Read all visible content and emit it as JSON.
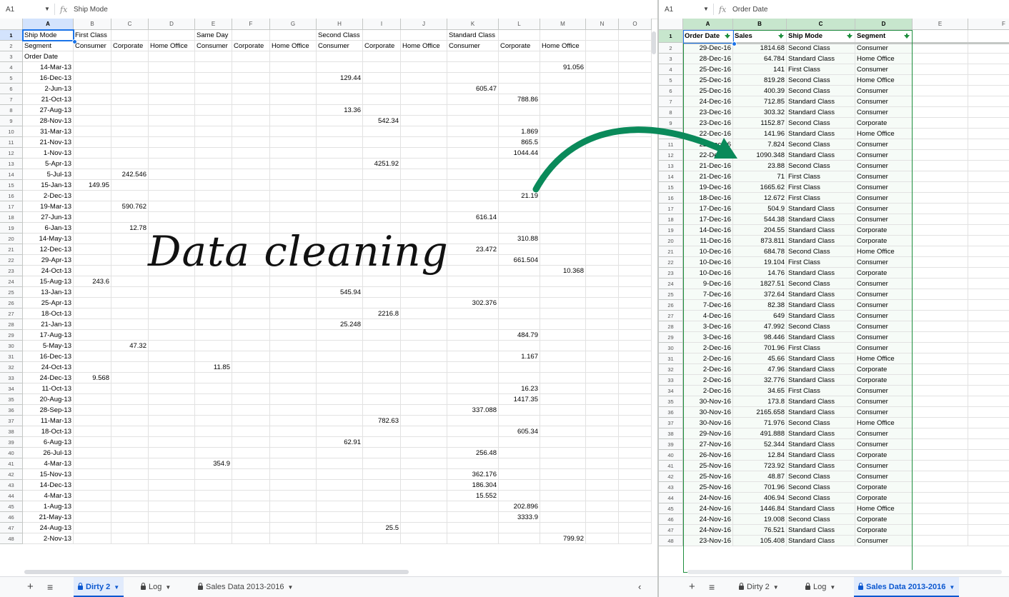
{
  "left": {
    "name_box": "A1",
    "formula": "Ship Mode",
    "columns": [
      "A",
      "B",
      "C",
      "D",
      "E",
      "F",
      "G",
      "H",
      "I",
      "J",
      "K",
      "L",
      "M",
      "N",
      "O"
    ],
    "rows": [
      [
        "Ship Mode",
        "First Class",
        "",
        "",
        "Same Day",
        "",
        "",
        "Second Class",
        "",
        "",
        "Standard Class",
        "",
        "",
        "",
        ""
      ],
      [
        "Segment",
        "Consumer",
        "Corporate",
        "Home Office",
        "Consumer",
        "Corporate",
        "Home Office",
        "Consumer",
        "Corporate",
        "Home Office",
        "Consumer",
        "Corporate",
        "Home Office",
        "",
        ""
      ],
      [
        "Order Date",
        "",
        "",
        "",
        "",
        "",
        "",
        "",
        "",
        "",
        "",
        "",
        "",
        "",
        ""
      ],
      [
        "14-Mar-13",
        "",
        "",
        "",
        "",
        "",
        "",
        "",
        "",
        "",
        "",
        "",
        "91.056",
        "",
        ""
      ],
      [
        "16-Dec-13",
        "",
        "",
        "",
        "",
        "",
        "",
        "129.44",
        "",
        "",
        "",
        "",
        "",
        "",
        ""
      ],
      [
        "2-Jun-13",
        "",
        "",
        "",
        "",
        "",
        "",
        "",
        "",
        "",
        "605.47",
        "",
        "",
        "",
        ""
      ],
      [
        "21-Oct-13",
        "",
        "",
        "",
        "",
        "",
        "",
        "",
        "",
        "",
        "",
        "788.86",
        "",
        "",
        ""
      ],
      [
        "27-Aug-13",
        "",
        "",
        "",
        "",
        "",
        "",
        "13.36",
        "",
        "",
        "",
        "",
        "",
        "",
        ""
      ],
      [
        "28-Nov-13",
        "",
        "",
        "",
        "",
        "",
        "",
        "",
        "542.34",
        "",
        "",
        "",
        "",
        "",
        ""
      ],
      [
        "31-Mar-13",
        "",
        "",
        "",
        "",
        "",
        "",
        "",
        "",
        "",
        "",
        "1.869",
        "",
        "",
        ""
      ],
      [
        "21-Nov-13",
        "",
        "",
        "",
        "",
        "",
        "",
        "",
        "",
        "",
        "",
        "865.5",
        "",
        "",
        ""
      ],
      [
        "1-Nov-13",
        "",
        "",
        "",
        "",
        "",
        "",
        "",
        "",
        "",
        "",
        "1044.44",
        "",
        "",
        ""
      ],
      [
        "5-Apr-13",
        "",
        "",
        "",
        "",
        "",
        "",
        "",
        "4251.92",
        "",
        "",
        "",
        "",
        "",
        ""
      ],
      [
        "5-Jul-13",
        "",
        "242.546",
        "",
        "",
        "",
        "",
        "",
        "",
        "",
        "",
        "",
        "",
        "",
        ""
      ],
      [
        "15-Jan-13",
        "149.95",
        "",
        "",
        "",
        "",
        "",
        "",
        "",
        "",
        "",
        "",
        "",
        "",
        ""
      ],
      [
        "2-Dec-13",
        "",
        "",
        "",
        "",
        "",
        "",
        "",
        "",
        "",
        "",
        "21.19",
        "",
        "",
        ""
      ],
      [
        "19-Mar-13",
        "",
        "590.762",
        "",
        "",
        "",
        "",
        "",
        "",
        "",
        "",
        "",
        "",
        "",
        ""
      ],
      [
        "27-Jun-13",
        "",
        "",
        "",
        "",
        "",
        "",
        "",
        "",
        "",
        "616.14",
        "",
        "",
        "",
        ""
      ],
      [
        "6-Jan-13",
        "",
        "12.78",
        "",
        "",
        "",
        "",
        "",
        "",
        "",
        "",
        "",
        "",
        "",
        ""
      ],
      [
        "14-May-13",
        "",
        "",
        "",
        "",
        "",
        "",
        "",
        "",
        "",
        "",
        "310.88",
        "",
        "",
        ""
      ],
      [
        "12-Dec-13",
        "",
        "",
        "",
        "",
        "",
        "",
        "",
        "",
        "",
        "23.472",
        "",
        "",
        "",
        ""
      ],
      [
        "29-Apr-13",
        "",
        "",
        "",
        "",
        "",
        "",
        "",
        "",
        "",
        "",
        "661.504",
        "",
        "",
        ""
      ],
      [
        "24-Oct-13",
        "",
        "",
        "",
        "",
        "",
        "",
        "",
        "",
        "",
        "",
        "",
        "10.368",
        "",
        ""
      ],
      [
        "15-Aug-13",
        "243.6",
        "",
        "",
        "",
        "",
        "",
        "",
        "",
        "",
        "",
        "",
        "",
        "",
        ""
      ],
      [
        "13-Jan-13",
        "",
        "",
        "",
        "",
        "",
        "",
        "545.94",
        "",
        "",
        "",
        "",
        "",
        "",
        ""
      ],
      [
        "25-Apr-13",
        "",
        "",
        "",
        "",
        "",
        "",
        "",
        "",
        "",
        "302.376",
        "",
        "",
        "",
        ""
      ],
      [
        "18-Oct-13",
        "",
        "",
        "",
        "",
        "",
        "",
        "",
        "2216.8",
        "",
        "",
        "",
        "",
        "",
        ""
      ],
      [
        "21-Jan-13",
        "",
        "",
        "",
        "",
        "",
        "",
        "25.248",
        "",
        "",
        "",
        "",
        "",
        "",
        ""
      ],
      [
        "17-Aug-13",
        "",
        "",
        "",
        "",
        "",
        "",
        "",
        "",
        "",
        "",
        "484.79",
        "",
        "",
        ""
      ],
      [
        "5-May-13",
        "",
        "47.32",
        "",
        "",
        "",
        "",
        "",
        "",
        "",
        "",
        "",
        "",
        "",
        ""
      ],
      [
        "16-Dec-13",
        "",
        "",
        "",
        "",
        "",
        "",
        "",
        "",
        "",
        "",
        "1.167",
        "",
        "",
        ""
      ],
      [
        "24-Oct-13",
        "",
        "",
        "",
        "11.85",
        "",
        "",
        "",
        "",
        "",
        "",
        "",
        "",
        "",
        ""
      ],
      [
        "24-Dec-13",
        "9.568",
        "",
        "",
        "",
        "",
        "",
        "",
        "",
        "",
        "",
        "",
        "",
        "",
        ""
      ],
      [
        "11-Oct-13",
        "",
        "",
        "",
        "",
        "",
        "",
        "",
        "",
        "",
        "",
        "16.23",
        "",
        "",
        ""
      ],
      [
        "20-Aug-13",
        "",
        "",
        "",
        "",
        "",
        "",
        "",
        "",
        "",
        "",
        "1417.35",
        "",
        "",
        ""
      ],
      [
        "28-Sep-13",
        "",
        "",
        "",
        "",
        "",
        "",
        "",
        "",
        "",
        "337.088",
        "",
        "",
        "",
        ""
      ],
      [
        "11-Mar-13",
        "",
        "",
        "",
        "",
        "",
        "",
        "",
        "782.63",
        "",
        "",
        "",
        "",
        "",
        ""
      ],
      [
        "18-Oct-13",
        "",
        "",
        "",
        "",
        "",
        "",
        "",
        "",
        "",
        "",
        "605.34",
        "",
        "",
        ""
      ],
      [
        "6-Aug-13",
        "",
        "",
        "",
        "",
        "",
        "",
        "62.91",
        "",
        "",
        "",
        "",
        "",
        "",
        ""
      ],
      [
        "26-Jul-13",
        "",
        "",
        "",
        "",
        "",
        "",
        "",
        "",
        "",
        "256.48",
        "",
        "",
        "",
        ""
      ],
      [
        "4-Mar-13",
        "",
        "",
        "",
        "354.9",
        "",
        "",
        "",
        "",
        "",
        "",
        "",
        "",
        "",
        ""
      ],
      [
        "15-Nov-13",
        "",
        "",
        "",
        "",
        "",
        "",
        "",
        "",
        "",
        "362.176",
        "",
        "",
        "",
        ""
      ],
      [
        "14-Dec-13",
        "",
        "",
        "",
        "",
        "",
        "",
        "",
        "",
        "",
        "186.304",
        "",
        "",
        "",
        ""
      ],
      [
        "4-Mar-13",
        "",
        "",
        "",
        "",
        "",
        "",
        "",
        "",
        "",
        "15.552",
        "",
        "",
        "",
        ""
      ],
      [
        "1-Aug-13",
        "",
        "",
        "",
        "",
        "",
        "",
        "",
        "",
        "",
        "",
        "202.896",
        "",
        "",
        ""
      ],
      [
        "21-May-13",
        "",
        "",
        "",
        "",
        "",
        "",
        "",
        "",
        "",
        "",
        "3333.9",
        "",
        "",
        ""
      ],
      [
        "24-Aug-13",
        "",
        "",
        "",
        "",
        "",
        "",
        "",
        "25.5",
        "",
        "",
        "",
        "",
        "",
        ""
      ],
      [
        "2-Nov-13",
        "",
        "",
        "",
        "",
        "",
        "",
        "",
        "",
        "",
        "",
        "",
        "799.92",
        "",
        ""
      ]
    ],
    "tabs": [
      {
        "label": "Dirty 2",
        "locked": true,
        "active": true
      },
      {
        "label": "Log",
        "locked": true,
        "active": false
      },
      {
        "label": "Sales Data 2013-2016",
        "locked": true,
        "active": false
      }
    ]
  },
  "right": {
    "name_box": "A1",
    "formula": "Order Date",
    "columns": [
      "A",
      "B",
      "C",
      "D",
      "E",
      "F"
    ],
    "rows": [
      [
        "Order Date",
        "Sales",
        "Ship Mode",
        "Segment",
        "",
        ""
      ],
      [
        "29-Dec-16",
        "1814.68",
        "Second Class",
        "Consumer",
        "",
        ""
      ],
      [
        "28-Dec-16",
        "64.784",
        "Standard Class",
        "Home Office",
        "",
        ""
      ],
      [
        "25-Dec-16",
        "141",
        "First Class",
        "Consumer",
        "",
        ""
      ],
      [
        "25-Dec-16",
        "819.28",
        "Second Class",
        "Home Office",
        "",
        ""
      ],
      [
        "25-Dec-16",
        "400.39",
        "Second Class",
        "Consumer",
        "",
        ""
      ],
      [
        "24-Dec-16",
        "712.85",
        "Standard Class",
        "Consumer",
        "",
        ""
      ],
      [
        "23-Dec-16",
        "303.32",
        "Standard Class",
        "Consumer",
        "",
        ""
      ],
      [
        "23-Dec-16",
        "1152.87",
        "Second Class",
        "Corporate",
        "",
        ""
      ],
      [
        "22-Dec-16",
        "141.96",
        "Standard Class",
        "Home Office",
        "",
        ""
      ],
      [
        "22-Dec-16",
        "7.824",
        "Second Class",
        "Consumer",
        "",
        ""
      ],
      [
        "22-Dec-16",
        "1090.348",
        "Standard Class",
        "Consumer",
        "",
        ""
      ],
      [
        "21-Dec-16",
        "23.88",
        "Second Class",
        "Consumer",
        "",
        ""
      ],
      [
        "21-Dec-16",
        "71",
        "First Class",
        "Consumer",
        "",
        ""
      ],
      [
        "19-Dec-16",
        "1665.62",
        "First Class",
        "Consumer",
        "",
        ""
      ],
      [
        "18-Dec-16",
        "12.672",
        "First Class",
        "Consumer",
        "",
        ""
      ],
      [
        "17-Dec-16",
        "504.9",
        "Standard Class",
        "Consumer",
        "",
        ""
      ],
      [
        "17-Dec-16",
        "544.38",
        "Standard Class",
        "Consumer",
        "",
        ""
      ],
      [
        "14-Dec-16",
        "204.55",
        "Standard Class",
        "Corporate",
        "",
        ""
      ],
      [
        "11-Dec-16",
        "873.811",
        "Standard Class",
        "Corporate",
        "",
        ""
      ],
      [
        "10-Dec-16",
        "684.78",
        "Second Class",
        "Home Office",
        "",
        ""
      ],
      [
        "10-Dec-16",
        "19.104",
        "First Class",
        "Consumer",
        "",
        ""
      ],
      [
        "10-Dec-16",
        "14.76",
        "Standard Class",
        "Corporate",
        "",
        ""
      ],
      [
        "9-Dec-16",
        "1827.51",
        "Second Class",
        "Consumer",
        "",
        ""
      ],
      [
        "7-Dec-16",
        "372.64",
        "Standard Class",
        "Consumer",
        "",
        ""
      ],
      [
        "7-Dec-16",
        "82.38",
        "Standard Class",
        "Consumer",
        "",
        ""
      ],
      [
        "4-Dec-16",
        "649",
        "Standard Class",
        "Consumer",
        "",
        ""
      ],
      [
        "3-Dec-16",
        "47.992",
        "Second Class",
        "Consumer",
        "",
        ""
      ],
      [
        "3-Dec-16",
        "98.446",
        "Standard Class",
        "Consumer",
        "",
        ""
      ],
      [
        "2-Dec-16",
        "701.96",
        "First Class",
        "Consumer",
        "",
        ""
      ],
      [
        "2-Dec-16",
        "45.66",
        "Standard Class",
        "Home Office",
        "",
        ""
      ],
      [
        "2-Dec-16",
        "47.96",
        "Standard Class",
        "Corporate",
        "",
        ""
      ],
      [
        "2-Dec-16",
        "32.776",
        "Standard Class",
        "Corporate",
        "",
        ""
      ],
      [
        "2-Dec-16",
        "34.65",
        "First Class",
        "Consumer",
        "",
        ""
      ],
      [
        "30-Nov-16",
        "173.8",
        "Standard Class",
        "Consumer",
        "",
        ""
      ],
      [
        "30-Nov-16",
        "2165.658",
        "Standard Class",
        "Consumer",
        "",
        ""
      ],
      [
        "30-Nov-16",
        "71.976",
        "Second Class",
        "Home Office",
        "",
        ""
      ],
      [
        "29-Nov-16",
        "491.888",
        "Standard Class",
        "Consumer",
        "",
        ""
      ],
      [
        "27-Nov-16",
        "52.344",
        "Standard Class",
        "Consumer",
        "",
        ""
      ],
      [
        "26-Nov-16",
        "12.84",
        "Standard Class",
        "Corporate",
        "",
        ""
      ],
      [
        "25-Nov-16",
        "723.92",
        "Standard Class",
        "Consumer",
        "",
        ""
      ],
      [
        "25-Nov-16",
        "48.87",
        "Second Class",
        "Consumer",
        "",
        ""
      ],
      [
        "25-Nov-16",
        "701.96",
        "Second Class",
        "Corporate",
        "",
        ""
      ],
      [
        "24-Nov-16",
        "406.94",
        "Second Class",
        "Corporate",
        "",
        ""
      ],
      [
        "24-Nov-16",
        "1446.84",
        "Standard Class",
        "Home Office",
        "",
        ""
      ],
      [
        "24-Nov-16",
        "19.008",
        "Second Class",
        "Corporate",
        "",
        ""
      ],
      [
        "24-Nov-16",
        "76.521",
        "Standard Class",
        "Corporate",
        "",
        ""
      ],
      [
        "23-Nov-16",
        "105.408",
        "Standard Class",
        "Consumer",
        "",
        ""
      ]
    ],
    "tabs": [
      {
        "label": "Dirty 2",
        "locked": true,
        "active": false
      },
      {
        "label": "Log",
        "locked": true,
        "active": false
      },
      {
        "label": "Sales Data 2013-2016",
        "locked": true,
        "active": true
      }
    ]
  },
  "overlay": {
    "title": "Data cleaning",
    "arrow_color": "#0a8a5a"
  },
  "icons": {
    "add_sheet": "plus-icon",
    "all_sheets": "menu-lines-icon",
    "scroll_tabs": "chevron-left-icon"
  },
  "colors": {
    "selection_blue": "#1a73e8",
    "active_tab": "#0b57d0",
    "filter_green": "#1e8e3e"
  }
}
